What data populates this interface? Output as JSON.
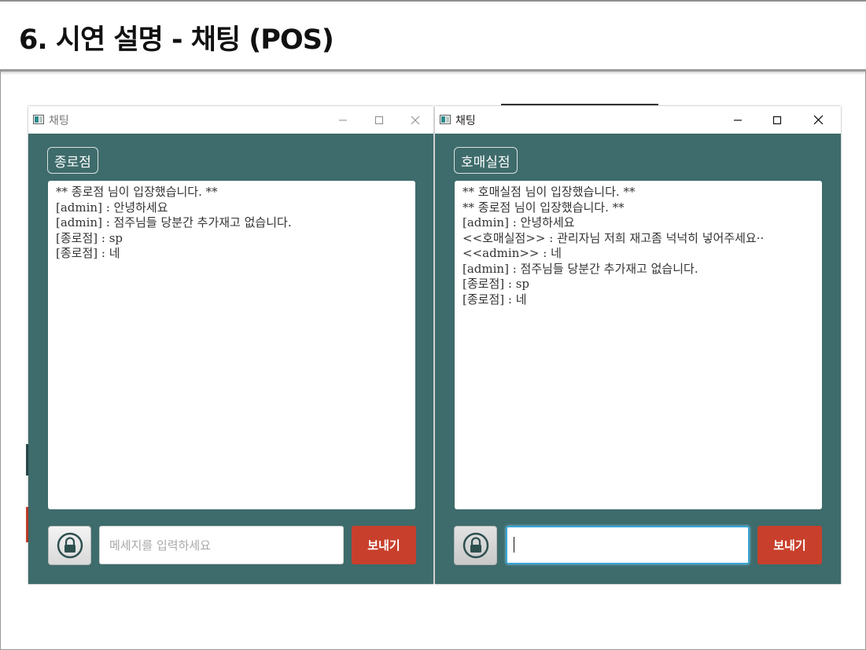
{
  "slide": {
    "title": "6. 시연 설명 - 채팅 (POS)"
  },
  "windows": [
    {
      "title": "채팅",
      "user_button": "종로점",
      "messages": [
        "** 종로점 님이 입장했습니다. **",
        "[admin] : 안녕하세요",
        "[admin] : 점주님들 당분간 추가재고 없습니다.",
        "[종로점] : sp",
        "[종로점] : 네"
      ],
      "input_value": "",
      "input_placeholder": "메세지를 입력하세요",
      "send_label": "보내기",
      "active": false
    },
    {
      "title": "채팅",
      "user_button": "호매실점",
      "messages": [
        "** 호매실점 님이 입장했습니다. **",
        "** 종로점 님이 입장했습니다. **",
        "[admin] : 안녕하세요",
        "<<호매실점>> : 관리자님 저희 재고좀 넉넉히 넣어주세요··",
        "<<admin>> : 네",
        "[admin] : 점주님들 당분간 추가재고 없습니다.",
        "[종로점] : sp",
        "[종로점] : 네"
      ],
      "input_value": "",
      "send_label": "보내기",
      "active": true
    }
  ],
  "colors": {
    "window_bg": "#3e6b6b",
    "send_button": "#c8402c",
    "focus_border": "#39a6d6"
  },
  "icons": {
    "lock_button": "lock-icon",
    "minimize": "minimize-icon",
    "maximize": "maximize-icon",
    "close": "close-icon",
    "app": "app-window-icon"
  }
}
